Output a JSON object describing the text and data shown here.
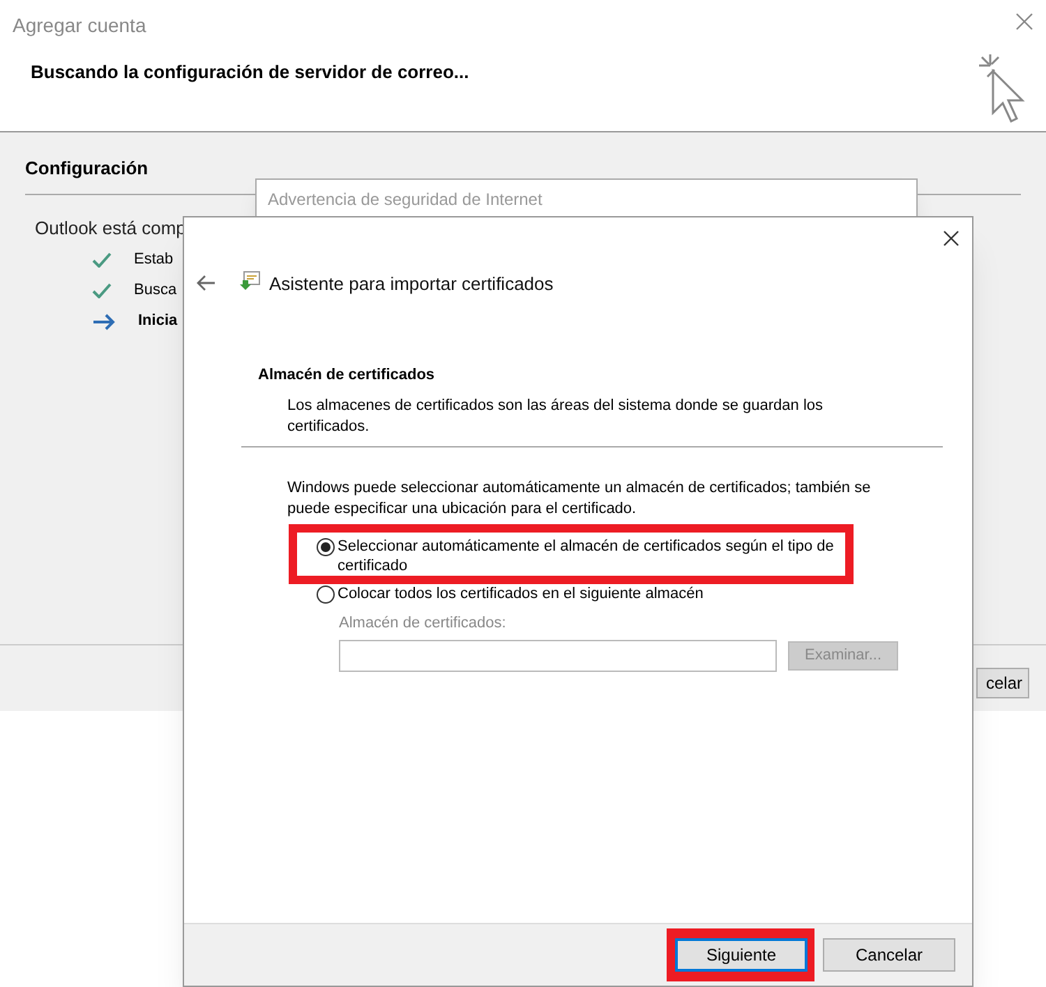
{
  "background_window": {
    "title": "Agregar cuenta",
    "heading": "Buscando la configuración de servidor de correo...",
    "section": "Configuración",
    "status_text": "Outlook está comp",
    "steps": [
      {
        "label": "Estab",
        "kind": "done"
      },
      {
        "label": "Busca",
        "kind": "done"
      },
      {
        "label": "Inicia",
        "kind": "current"
      }
    ],
    "cancel_button": "celar"
  },
  "middle_window": {
    "title": "Advertencia de seguridad de Internet"
  },
  "wizard": {
    "title": "Asistente para importar certificados",
    "section_title": "Almacén de certificados",
    "section_description": "Los almacenes de certificados son las áreas del sistema donde se guardan los certificados.",
    "intro": "Windows puede seleccionar automáticamente un almacén de certificados; también se puede especificar una ubicación para el certificado.",
    "options": [
      {
        "label": "Seleccionar automáticamente el almacén de certificados según el tipo de certificado",
        "selected": true,
        "highlighted": true
      },
      {
        "label": "Colocar todos los certificados en el siguiente almacén",
        "selected": false,
        "highlighted": false
      }
    ],
    "store_label": "Almacén de certificados:",
    "browse_button": {
      "label": "Examinar...",
      "disabled": true
    },
    "buttons": [
      {
        "label": "Siguiente",
        "default": true,
        "highlighted": true
      },
      {
        "label": "Cancelar",
        "default": false,
        "highlighted": false
      }
    ]
  }
}
